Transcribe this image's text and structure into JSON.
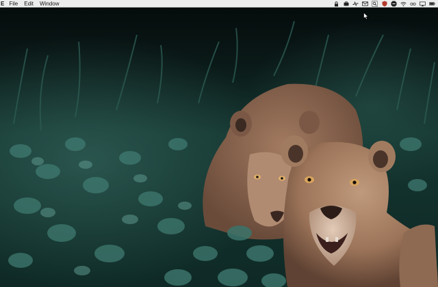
{
  "menubar": {
    "app_glyph": "E",
    "items": [
      {
        "label": "File"
      },
      {
        "label": "Edit"
      },
      {
        "label": "Window"
      }
    ],
    "tray_icons": [
      "lock-icon",
      "briefcase-icon",
      "activity-icon",
      "mail-icon",
      "search-icon",
      "shield-icon",
      "stop-icon",
      "wifi-icon",
      "glasses-icon",
      "airplay-icon",
      "battery-icon"
    ]
  },
  "desktop": {
    "wallpaper": "lionesses-in-grass",
    "colors": {
      "foliage_dark": "#0d2a26",
      "foliage_light": "#4f8a80",
      "lion_fur": "#a47a5e"
    }
  }
}
